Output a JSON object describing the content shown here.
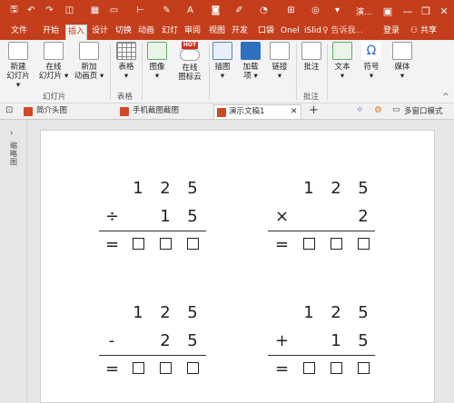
{
  "titlebar": {
    "title": "演...",
    "qat": [
      "save-icon",
      "undo-icon",
      "redo-icon",
      "presentation-icon",
      "table-icon",
      "shape-icon",
      "format-icon",
      "text-icon",
      "a-icon",
      "camera-icon",
      "brush-icon",
      "clock-icon",
      "grid-icon",
      "customize-icon"
    ]
  },
  "tabs": [
    "文件",
    "开始",
    "插入",
    "设计",
    "切换",
    "动画",
    "幻灯",
    "审阅",
    "视图",
    "开发",
    "口袋",
    "Onel",
    "iSlid"
  ],
  "tellme": "♀ 告诉我...",
  "login": "登录",
  "share": "共享",
  "ribbon": {
    "new_slide": "新建\n幻灯片",
    "online_slide": "在线\n幻灯片",
    "new_anim_page": "新加\n动画页",
    "table": "表格",
    "image": "图像",
    "online_icon": "在线\n图标云",
    "illustration": "插图",
    "addin": "加载\n项",
    "link": "链接",
    "comment": "批注",
    "text": "文本",
    "symbol": "符号",
    "media": "媒体",
    "group_slides": "幻灯片",
    "group_table": "表格",
    "group_comment": "批注",
    "hot_badge": "HOT"
  },
  "doctabs": {
    "tab1": "简介头图",
    "tab2": "手机截图截图",
    "tab3": "演示文稿1",
    "multiwindow": "多窗口模式"
  },
  "leftpanel": {
    "label": "缩略图"
  },
  "math": {
    "problems": [
      {
        "top": [
          "1",
          "2",
          "5"
        ],
        "op": "÷",
        "bottom": [
          "1",
          "5"
        ]
      },
      {
        "top": [
          "1",
          "2",
          "5"
        ],
        "op": "×",
        "bottom": [
          "2"
        ]
      },
      {
        "top": [
          "1",
          "2",
          "5"
        ],
        "op": "-",
        "bottom": [
          "2",
          "5"
        ]
      },
      {
        "top": [
          "1",
          "2",
          "5"
        ],
        "op": "+",
        "bottom": [
          "1",
          "5"
        ]
      }
    ],
    "equals": "="
  }
}
